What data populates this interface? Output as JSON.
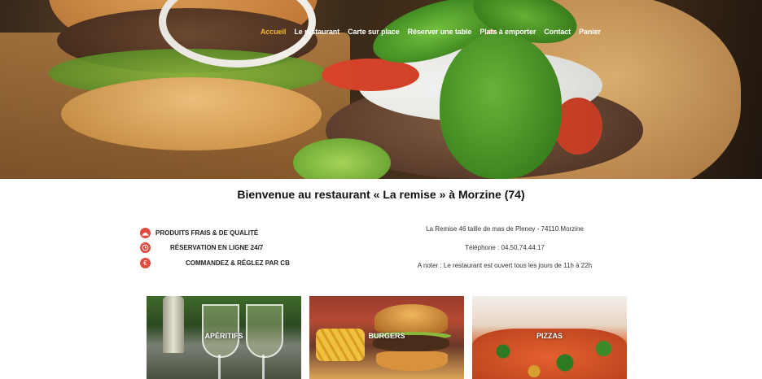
{
  "nav": {
    "items": [
      {
        "label": "Accueil",
        "active": true
      },
      {
        "label": "Le restaurant"
      },
      {
        "label": "Carte sur place"
      },
      {
        "label": "Réserver une table"
      },
      {
        "label": "Plats à emporter"
      },
      {
        "label": "Contact"
      },
      {
        "label": "Panier"
      }
    ]
  },
  "main": {
    "title": "Bienvenue au restaurant « La remise » à Morzine (74)",
    "features": [
      {
        "label": "PRODUITS FRAIS & DE QUALITÉ",
        "icon": "dish-icon"
      },
      {
        "label": "RÉSERVATION EN LIGNE 24/7",
        "icon": "clock-icon"
      },
      {
        "label": "COMMANDEZ & RÉGLEZ PAR CB",
        "icon": "euro-icon"
      }
    ],
    "contact": {
      "address": "La Remise 46 taille de mas de Pleney - 74110 Morzine",
      "phone": "Téléphone : 04.50.74.44.17",
      "note": "A noter : Le restaurant est ouvert tous les jours de 11h à 22h"
    }
  },
  "cards": [
    {
      "label": "APÉRITIFS"
    },
    {
      "label": "BURGERS"
    },
    {
      "label": "PIZZAS"
    }
  ],
  "colors": {
    "accent": "#f2b632",
    "icon_red": "#e04a3e"
  }
}
